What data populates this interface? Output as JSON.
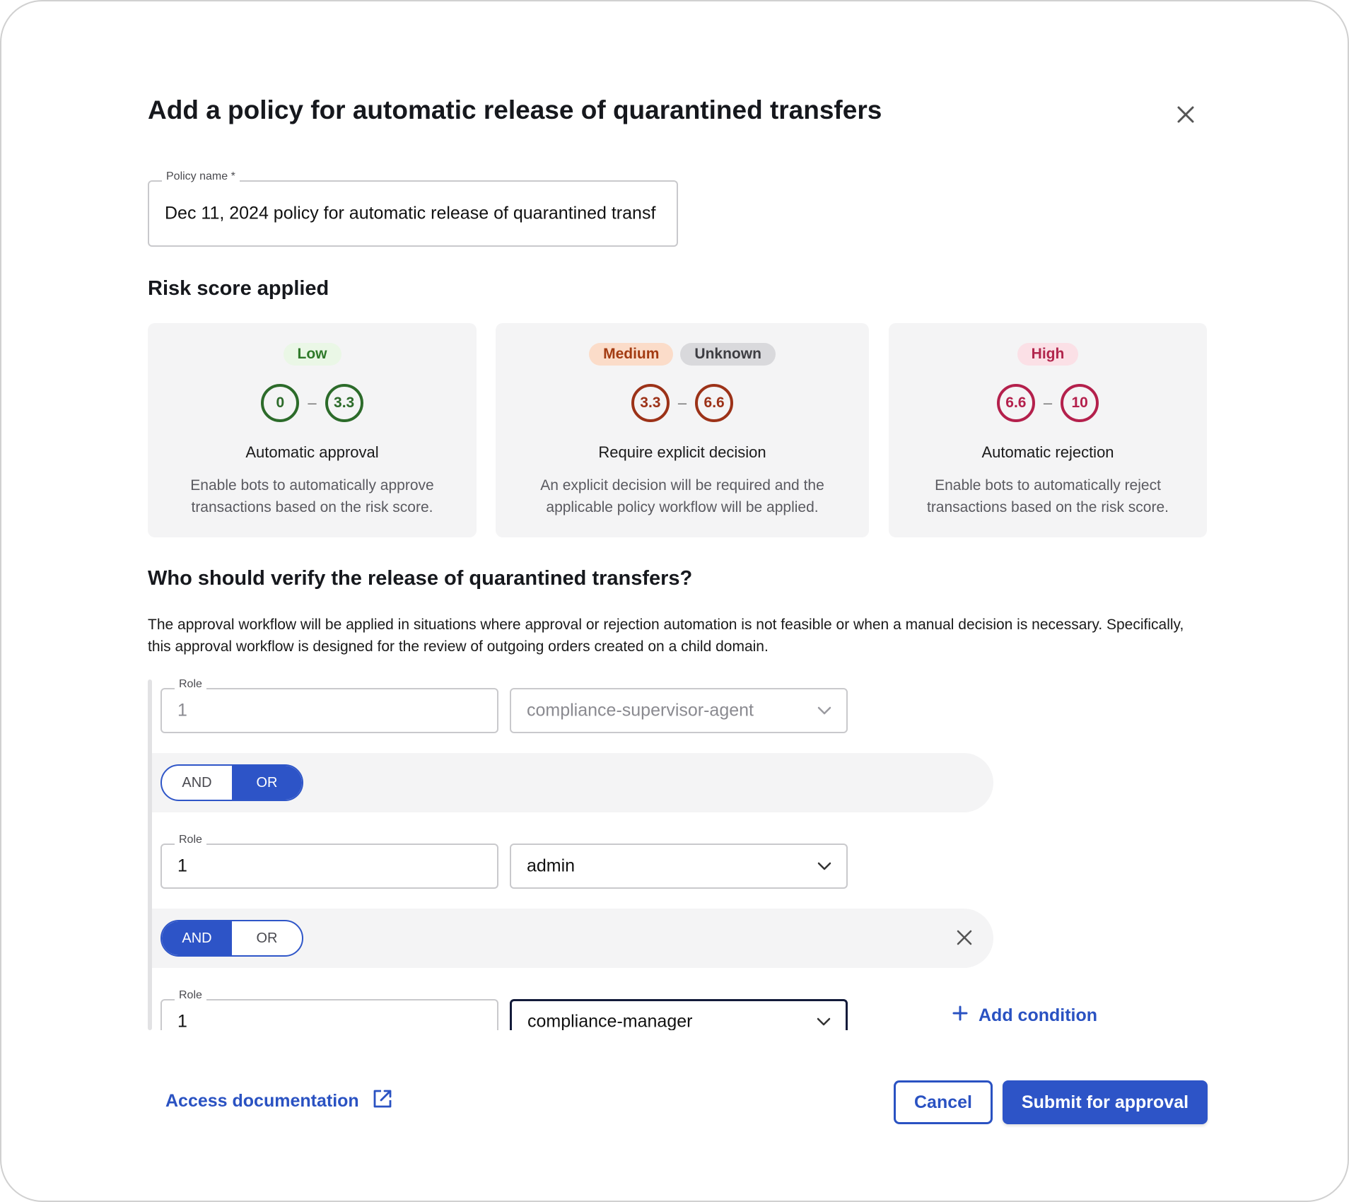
{
  "dialog": {
    "title": "Add a policy for automatic release of quarantined transfers"
  },
  "policy_name": {
    "label": "Policy name *",
    "value": "Dec 11, 2024 policy for automatic release of quarantined transf"
  },
  "risk": {
    "heading": "Risk score applied",
    "cards": [
      {
        "badges": [
          "Low"
        ],
        "range_min": "0",
        "range_max": "3.3",
        "title": "Automatic approval",
        "description": "Enable bots to automatically approve transactions based on the risk score."
      },
      {
        "badges": [
          "Medium",
          "Unknown"
        ],
        "range_min": "3.3",
        "range_max": "6.6",
        "title": "Require explicit decision",
        "description": "An explicit decision will be required and the applicable policy workflow will be applied."
      },
      {
        "badges": [
          "High"
        ],
        "range_min": "6.6",
        "range_max": "10",
        "title": "Automatic rejection",
        "description": "Enable bots to automatically reject transactions based on the risk score."
      }
    ]
  },
  "verify": {
    "heading": "Who should verify the release of quarantined transfers?",
    "description": "The approval workflow will be applied in situations where approval or rejection automation is not feasible or when a manual decision is necessary. Specifically, this approval workflow is designed for the review of outgoing orders created on a child domain."
  },
  "workflow": {
    "conditions": [
      {
        "label": "Role",
        "count": "1",
        "role": "compliance-supervisor-agent",
        "disabled": true
      },
      {
        "label": "Role",
        "count": "1",
        "role": "admin",
        "disabled": false
      },
      {
        "label": "Role",
        "count": "1",
        "role": "compliance-manager",
        "disabled": false
      }
    ],
    "operators": [
      {
        "and_label": "AND",
        "or_label": "OR",
        "selected": "OR"
      },
      {
        "and_label": "AND",
        "or_label": "OR",
        "selected": "AND"
      }
    ],
    "add_condition_label": "Add condition"
  },
  "footer": {
    "doc_link_label": "Access documentation",
    "cancel_label": "Cancel",
    "submit_label": "Submit for approval"
  },
  "colors": {
    "primary": "#2d54c7",
    "low": "#2c6b2a",
    "medium": "#9c3218",
    "high": "#b4204c"
  },
  "icons": {
    "close": "close-icon",
    "chevron": "chevron-down-icon",
    "plus": "plus-icon",
    "external": "external-link-icon"
  }
}
